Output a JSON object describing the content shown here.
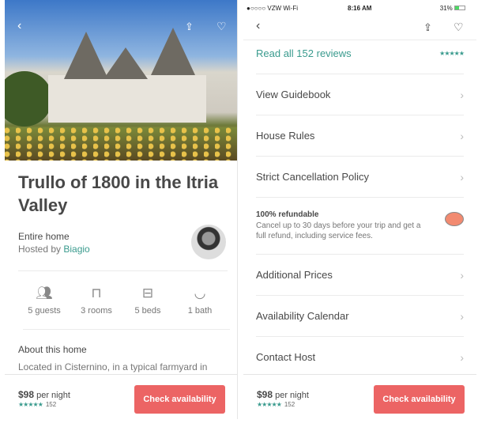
{
  "left": {
    "title": "Trullo of 1800 in the Itria Valley",
    "home_type": "Entire home",
    "hosted_by": "Hosted by",
    "host_name": "Biagio",
    "amenities": [
      {
        "icon": "guests-icon",
        "label": "5 guests"
      },
      {
        "icon": "door-icon",
        "label": "3 rooms"
      },
      {
        "icon": "bed-icon",
        "label": "5 beds"
      },
      {
        "icon": "bathtub-icon",
        "label": "1 bath"
      }
    ],
    "about_heading": "About this home",
    "about_text": "Located in Cisternino, in a typical farmyard in",
    "footer": {
      "price": "$98",
      "per_night": "per night",
      "rating": 4.5,
      "reviews": "152",
      "button": "Check availability"
    }
  },
  "right": {
    "status": {
      "carrier": "●○○○○ VZW Wi-Fi",
      "time": "8:16 AM",
      "battery": "31%"
    },
    "reviews_link": "Read all 152 reviews",
    "rating": 4.5,
    "rows": [
      "View Guidebook",
      "House Rules",
      "Strict Cancellation Policy"
    ],
    "refund": {
      "title": "100% refundable",
      "text": "Cancel up to 30 days before your trip and get a full refund, including service fees."
    },
    "rows2": [
      "Additional Prices",
      "Availability Calendar",
      "Contact Host"
    ],
    "footer": {
      "price": "$98",
      "per_night": "per night",
      "rating": 4.5,
      "reviews": "152",
      "button": "Check availability"
    }
  },
  "colors": {
    "accent": "#ec6464",
    "teal": "#3a9b8e"
  }
}
